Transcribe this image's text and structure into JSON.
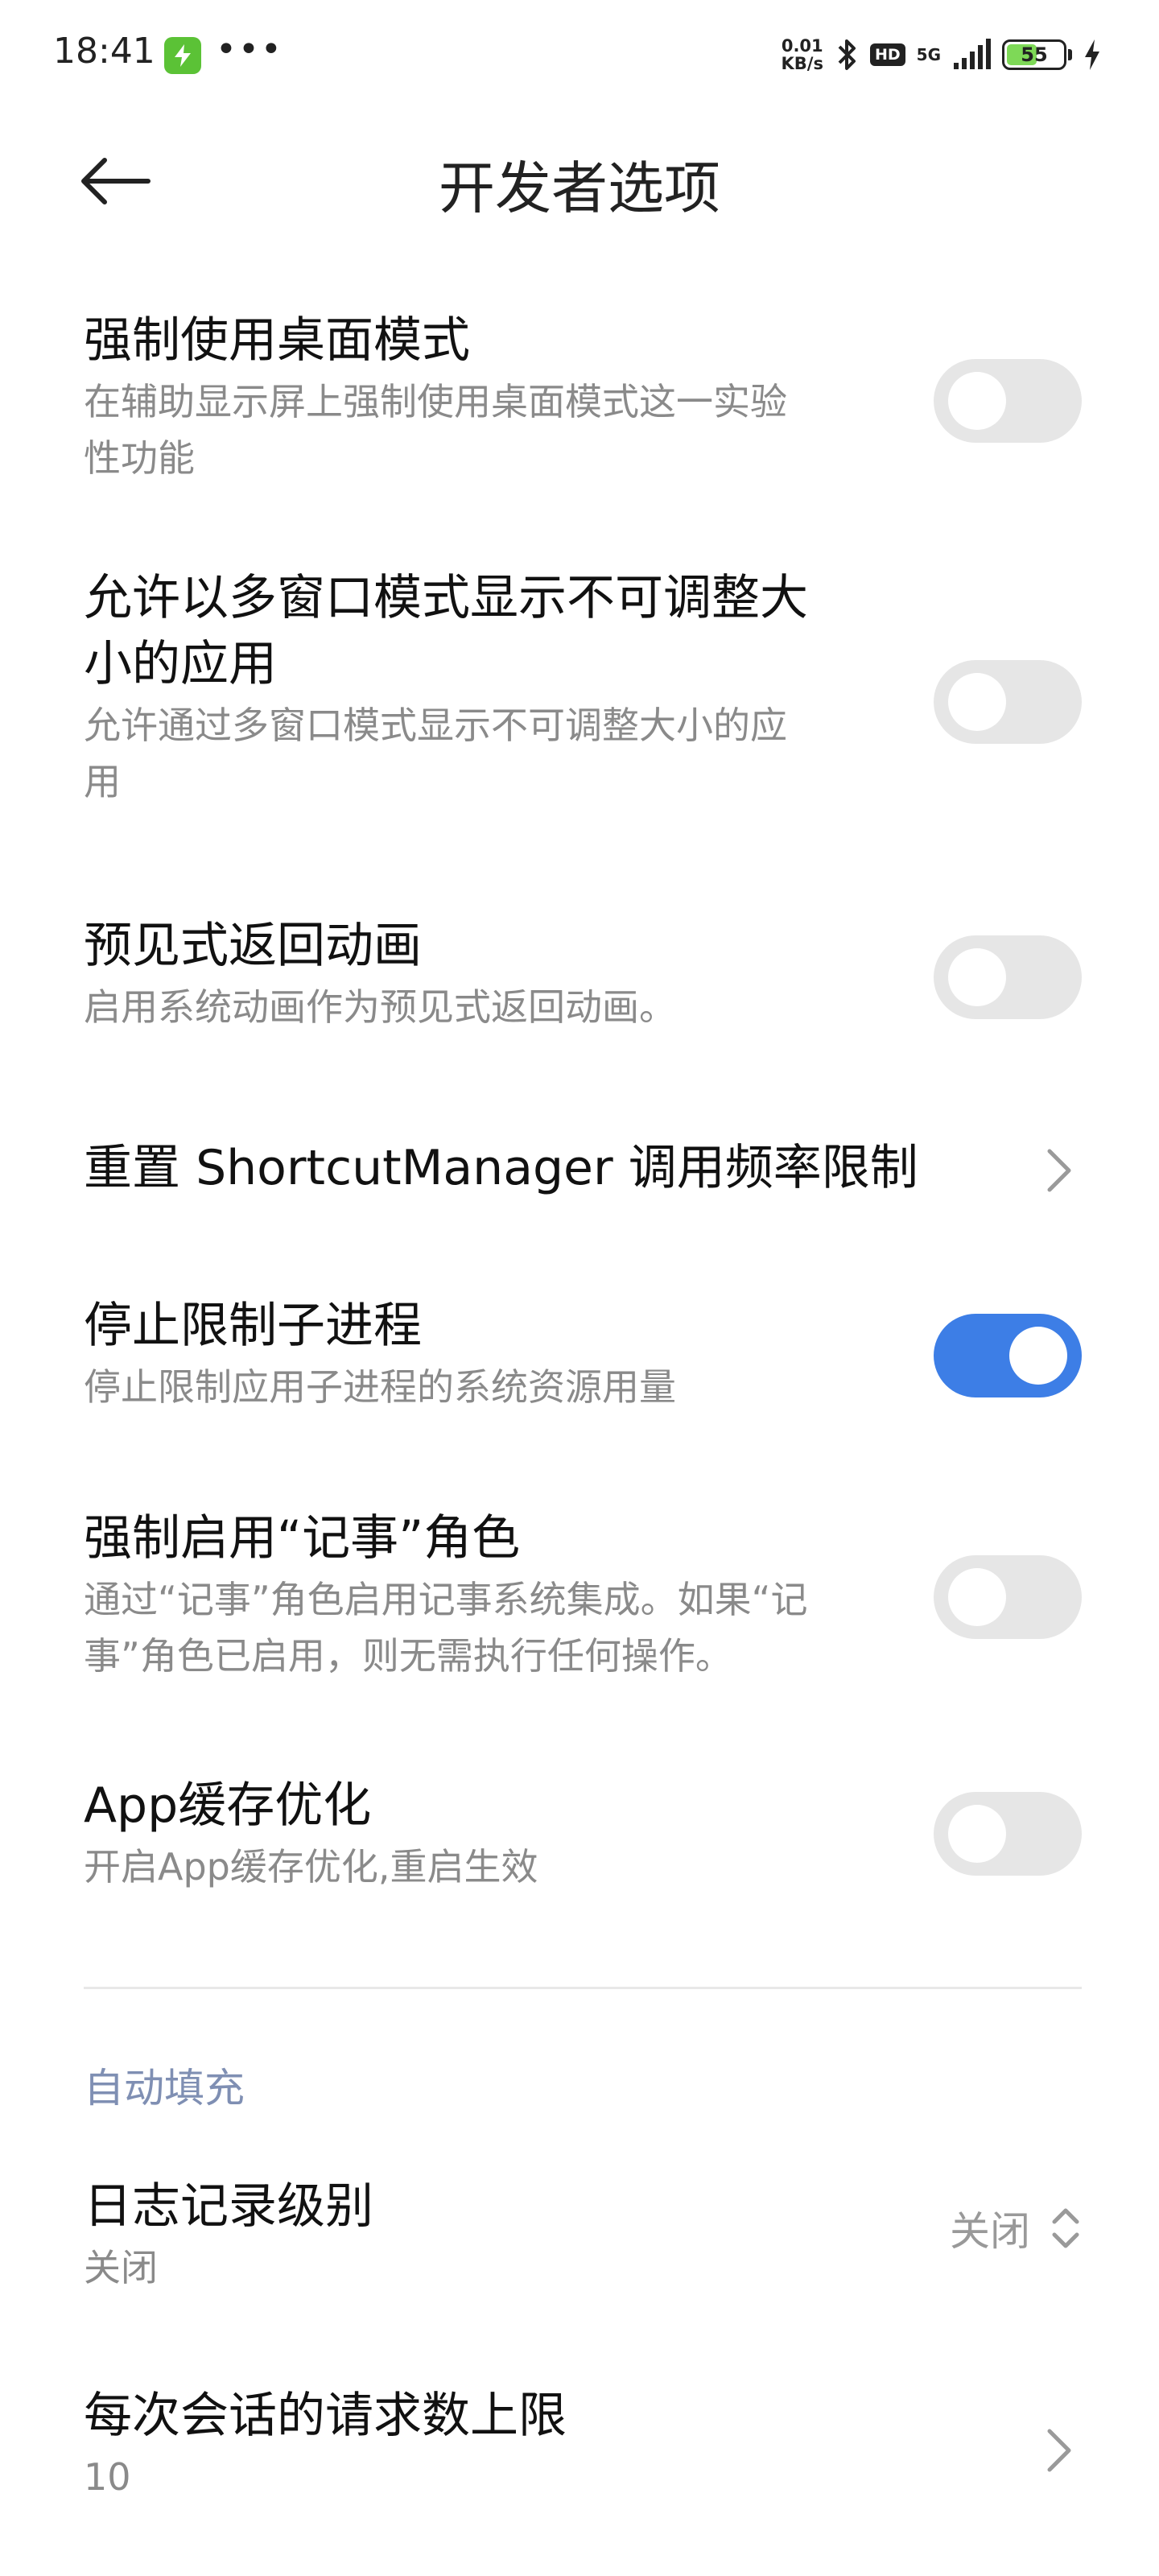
{
  "status_bar": {
    "time": "18:41",
    "more": "•••",
    "net_speed_value": "0.01",
    "net_speed_unit": "KB/s",
    "hd": "HD",
    "signal": "5G",
    "battery": "55",
    "battery_level": 0.55
  },
  "header": {
    "title": "开发者选项"
  },
  "settings": [
    {
      "title": "强制使用桌面模式",
      "subtitle_lines": [
        "在辅助显示屏上强制使用桌面模式这一实验",
        "性功能"
      ],
      "toggle": "off"
    },
    {
      "title_lines": [
        "允许以多窗口模式显示不可调整大",
        "小的应用"
      ],
      "subtitle_lines": [
        "允许通过多窗口模式显示不可调整大小的应",
        "用"
      ],
      "toggle": "off"
    },
    {
      "title": "预见式返回动画",
      "subtitle": "启用系统动画作为预见式返回动画。",
      "toggle": "off"
    },
    {
      "title": "重置 ShortcutManager 调用频率限制"
    },
    {
      "title": "停止限制子进程",
      "subtitle": "停止限制应用子进程的系统资源用量",
      "toggle": "on"
    },
    {
      "title": "强制启用“记事”角色",
      "subtitle_lines": [
        "通过“记事”角色启用记事系统集成。如果“记",
        "事”角色已启用，则无需执行任何操作。"
      ],
      "toggle": "off"
    },
    {
      "title": "App缓存优化",
      "subtitle": "开启App缓存优化,重启生效",
      "toggle": "off"
    }
  ],
  "autofill": {
    "section_title": "自动填充",
    "log_level": {
      "title": "日志记录级别",
      "subtitle": "关闭",
      "value": "关闭"
    },
    "max_requests": {
      "title": "每次会话的请求数上限",
      "subtitle": "10"
    }
  },
  "colors": {
    "toggle_on": "#3d7ee6",
    "toggle_off": "#e6e6e6",
    "section_header": "#7f8fb3",
    "subtitle": "#8a8a8a"
  }
}
